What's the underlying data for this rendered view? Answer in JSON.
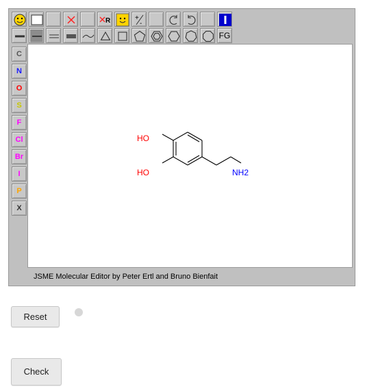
{
  "toolbar": {
    "row1": [
      "smiley-icon",
      "blank-square-icon",
      "blank",
      "delete-x-icon",
      "blank",
      "delete-r-icon",
      "smiley-square-icon",
      "charge-icon",
      "blank",
      "undo-icon",
      "redo-icon",
      "blank",
      "info-icon"
    ],
    "row2": [
      "single-bond-stub-icon",
      "single-bond-icon",
      "double-bond-icon",
      "triple-bond-icon",
      "chain-icon",
      "ring3-icon",
      "ring4-icon",
      "ring5-icon",
      "benzene-icon",
      "ring6-icon",
      "ring7-icon",
      "ring8-icon"
    ],
    "fg_label": "FG"
  },
  "elements": [
    {
      "symbol": "C",
      "color": "#555555"
    },
    {
      "symbol": "N",
      "color": "#1a1aff"
    },
    {
      "symbol": "O",
      "color": "#ff0000"
    },
    {
      "symbol": "S",
      "color": "#c8c800"
    },
    {
      "symbol": "F",
      "color": "#ff00ff"
    },
    {
      "symbol": "Cl",
      "color": "#ff00ff"
    },
    {
      "symbol": "Br",
      "color": "#ff00ff"
    },
    {
      "symbol": "I",
      "color": "#ff00ff"
    },
    {
      "symbol": "P",
      "color": "#ffa500"
    },
    {
      "symbol": "X",
      "color": "#333333"
    }
  ],
  "molecule": {
    "labels": [
      {
        "text": "HO",
        "color": "#ff0000"
      },
      {
        "text": "HO",
        "color": "#ff0000"
      },
      {
        "text": "NH2",
        "color": "#0000ff"
      }
    ]
  },
  "status_text": "JSME Molecular Editor by Peter Ertl and Bruno Bienfait",
  "buttons": {
    "reset": "Reset",
    "check": "Check"
  }
}
